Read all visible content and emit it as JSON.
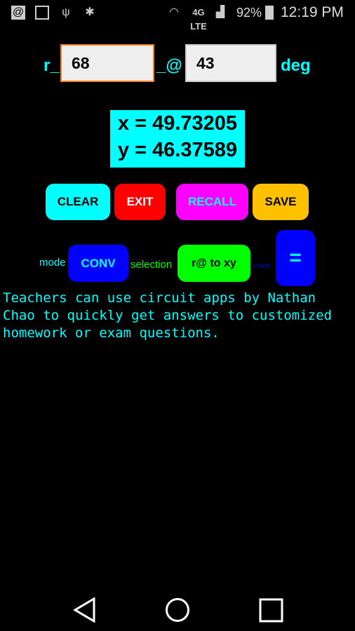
{
  "status_bar": {
    "battery": "92%",
    "time": "12:19 PM",
    "network": "4G LTE",
    "icons": [
      "at-icon",
      "image-icon",
      "usb-icon",
      "bug-icon",
      "wifi-icon",
      "signal-icon",
      "battery-charging-icon"
    ]
  },
  "inputs": {
    "r_label": "r_",
    "r_value": "68",
    "angle_label": "_@",
    "angle_value": "43",
    "unit_label": "deg"
  },
  "result": {
    "x": "x = 49.73205",
    "y": "y = 46.37589"
  },
  "buttons": {
    "clear": "CLEAR",
    "exit": "EXIT",
    "recall": "RECALL",
    "save": "SAVE",
    "conv": "CONV",
    "selection": "r@ to xy",
    "equals": "="
  },
  "labels": {
    "mode": "mode",
    "selection": "selection",
    "answer": "answer"
  },
  "message": "Teachers can use circuit apps by Nathan Chao to quickly get answers to customized homework or exam questions.",
  "colors": {
    "cyan": "#00ffff",
    "red": "#ff0000",
    "magenta": "#ff00ff",
    "yellow": "#ffc000",
    "blue": "#0000ff",
    "green": "#00ff00"
  }
}
